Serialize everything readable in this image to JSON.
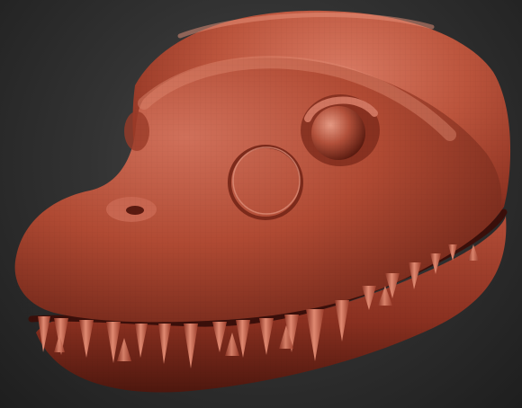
{
  "scene": {
    "subject": "sculpted-creature-head",
    "colors": {
      "background_center": "#4a4a4a",
      "background_edge": "#1e1e1e",
      "clay_highlight": "#d8745e",
      "clay_base": "#b24a34",
      "clay_shadow": "#5e1d12",
      "teeth": "#cf6650",
      "mouth_interior": "#3a0f0a"
    }
  }
}
